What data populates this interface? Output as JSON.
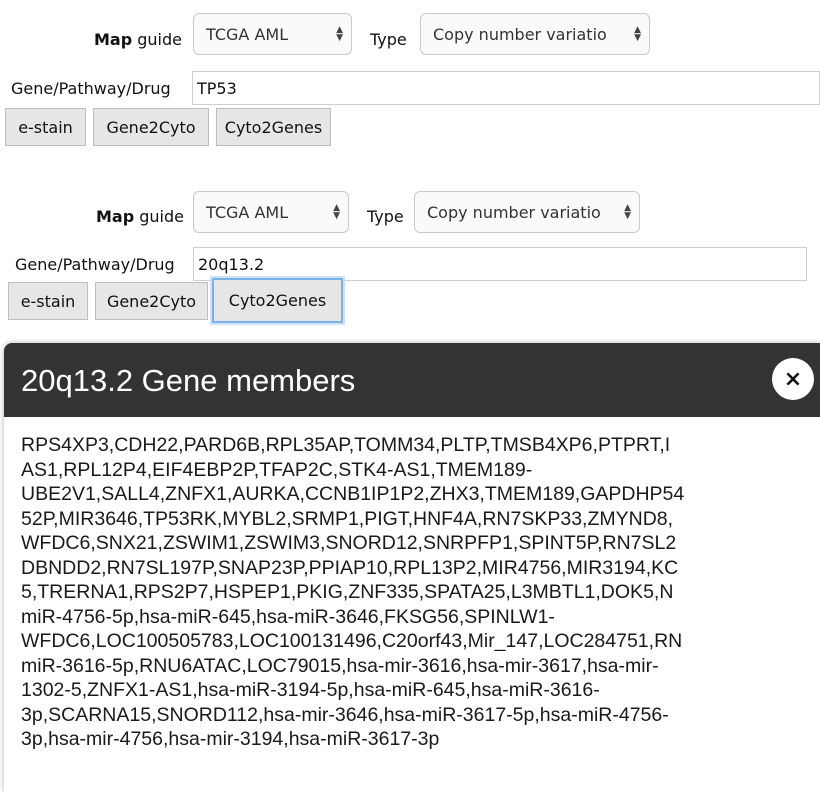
{
  "form_top": {
    "map_label_bold": "Map",
    "map_label_rest": " guide",
    "map_value": "TCGA AML",
    "type_label": "Type",
    "type_value": "Copy number variatio",
    "gene_label": "Gene/Pathway/Drug",
    "gene_value": "TP53",
    "buttons": {
      "estain": "e-stain",
      "gene2cyto": "Gene2Cyto",
      "cyto2genes": "Cyto2Genes"
    }
  },
  "form_bottom": {
    "map_label_bold": "Map",
    "map_label_rest": " guide",
    "map_value": "TCGA AML",
    "type_label": "Type",
    "type_value": "Copy number variatio",
    "gene_label": "Gene/Pathway/Drug",
    "gene_value": "20q13.2",
    "buttons": {
      "estain": "e-stain",
      "gene2cyto": "Gene2Cyto",
      "cyto2genes": "Cyto2Genes"
    }
  },
  "modal": {
    "title": "20q13.2 Gene members",
    "close_label": "×",
    "lines": [
      "RPS4XP3,CDH22,PARD6B,RPL35AP,TOMM34,PLTP,TMSB4XP6,PTPRT,I",
      "AS1,RPL12P4,EIF4EBP2P,TFAP2C,STK4-AS1,TMEM189-",
      "UBE2V1,SALL4,ZNFX1,AURKA,CCNB1IP1P2,ZHX3,TMEM189,GAPDHP54",
      "52P,MIR3646,TP53RK,MYBL2,SRMP1,PIGT,HNF4A,RN7SKP33,ZMYND8,",
      "WFDC6,SNX21,ZSWIM1,ZSWIM3,SNORD12,SNRPFP1,SPINT5P,RN7SL2",
      "DBNDD2,RN7SL197P,SNAP23P,PPIAP10,RPL13P2,MIR4756,MIR3194,KC",
      "5,TRERNA1,RPS2P7,HSPEP1,PKIG,ZNF335,SPATA25,L3MBTL1,DOK5,N",
      "miR-4756-5p,hsa-miR-645,hsa-miR-3646,FKSG56,SPINLW1-",
      "WFDC6,LOC100505783,LOC100131496,C20orf43,Mir_147,LOC284751,RN",
      "miR-3616-5p,RNU6ATAC,LOC79015,hsa-mir-3616,hsa-mir-3617,hsa-mir-",
      "1302-5,ZNFX1-AS1,hsa-miR-3194-5p,hsa-miR-645,hsa-miR-3616-",
      "3p,SCARNA15,SNORD112,hsa-mir-3646,hsa-miR-3617-5p,hsa-miR-4756-",
      "3p,hsa-mir-4756,hsa-mir-3194,hsa-miR-3617-3p"
    ]
  }
}
